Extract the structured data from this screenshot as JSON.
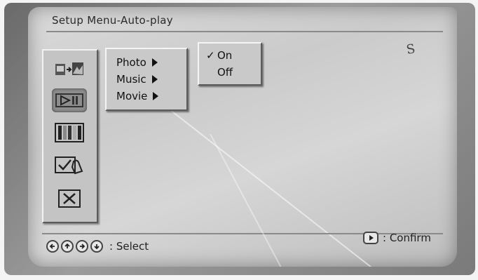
{
  "screen": {
    "title": "Setup Menu-Auto-play"
  },
  "sidebar": {
    "items": [
      {
        "name": "photo-transfer-icon"
      },
      {
        "name": "slideshow-play-icon"
      },
      {
        "name": "display-bars-icon"
      },
      {
        "name": "touch-check-icon"
      },
      {
        "name": "exit-x-icon"
      }
    ],
    "active_index": 1
  },
  "submenu": {
    "items": [
      {
        "label": "Photo"
      },
      {
        "label": "Music"
      },
      {
        "label": "Movie"
      }
    ]
  },
  "options": {
    "items": [
      {
        "label": "On",
        "check": "✓",
        "selected": true
      },
      {
        "label": "Off",
        "check": "",
        "selected": false
      }
    ]
  },
  "footer": {
    "nav_buttons": [
      "left-arrow-icon",
      "up-arrow-icon",
      "right-arrow-icon",
      "down-arrow-icon"
    ],
    "select_hint": ": Select",
    "confirm_hint": ": Confirm"
  }
}
